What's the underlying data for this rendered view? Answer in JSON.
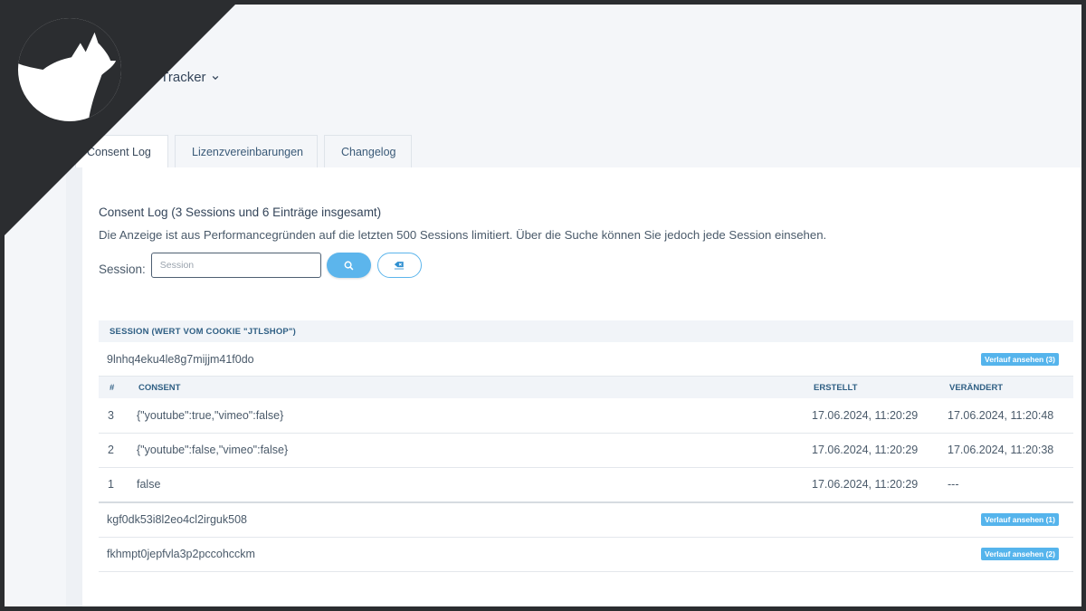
{
  "header": {
    "title": "sent Tracker"
  },
  "tabs": [
    {
      "label": "Consent Log",
      "active": true
    },
    {
      "label": "Lizenzvereinbarungen",
      "active": false
    },
    {
      "label": "Changelog",
      "active": false
    }
  ],
  "log": {
    "title": "Consent Log (3 Sessions und 6 Einträge insgesamt)",
    "description": "Die Anzeige ist aus Performancegründen auf die letzten 500 Sessions limitiert. Über die Suche können Sie jedoch jede Session einsehen."
  },
  "search": {
    "label": "Session:",
    "placeholder": "Session",
    "search_icon": "search-icon",
    "clear_icon": "eraser-icon"
  },
  "table": {
    "session_header": "SESSION (WERT VOM COOKIE \"JTLSHOP\")",
    "inner_headers": {
      "num": "#",
      "consent": "CONSENT",
      "created": "ERSTELLT",
      "changed": "VERÄNDERT"
    },
    "sessions": [
      {
        "id": "9lnhq4eku4le8g7mijjm41f0do",
        "badge": "Verlauf ansehen (3)",
        "entries": [
          {
            "num": "3",
            "consent": "{\"youtube\":true,\"vimeo\":false}",
            "created": "17.06.2024, 11:20:29",
            "changed": "17.06.2024, 11:20:48"
          },
          {
            "num": "2",
            "consent": "{\"youtube\":false,\"vimeo\":false}",
            "created": "17.06.2024, 11:20:29",
            "changed": "17.06.2024, 11:20:38"
          },
          {
            "num": "1",
            "consent": "false",
            "created": "17.06.2024, 11:20:29",
            "changed": "---"
          }
        ]
      },
      {
        "id": "kgf0dk53i8l2eo4cl2irguk508",
        "badge": "Verlauf ansehen (1)"
      },
      {
        "id": "fkhmpt0jepfvla3p2pccohcckm",
        "badge": "Verlauf ansehen (2)"
      }
    ]
  },
  "colors": {
    "accent": "#5cb5ec",
    "header_text": "#2f5f84",
    "frame": "#2b2d30"
  }
}
